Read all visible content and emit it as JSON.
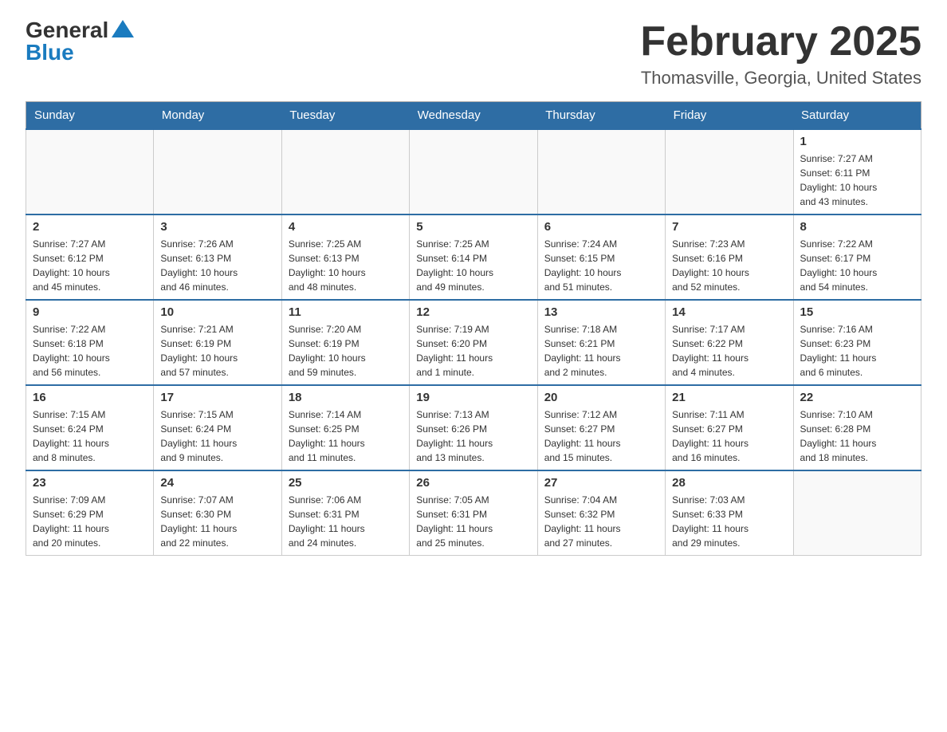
{
  "logo": {
    "general": "General",
    "blue": "Blue"
  },
  "header": {
    "month_year": "February 2025",
    "location": "Thomasville, Georgia, United States"
  },
  "weekdays": [
    "Sunday",
    "Monday",
    "Tuesday",
    "Wednesday",
    "Thursday",
    "Friday",
    "Saturday"
  ],
  "weeks": [
    [
      {
        "day": "",
        "info": ""
      },
      {
        "day": "",
        "info": ""
      },
      {
        "day": "",
        "info": ""
      },
      {
        "day": "",
        "info": ""
      },
      {
        "day": "",
        "info": ""
      },
      {
        "day": "",
        "info": ""
      },
      {
        "day": "1",
        "info": "Sunrise: 7:27 AM\nSunset: 6:11 PM\nDaylight: 10 hours\nand 43 minutes."
      }
    ],
    [
      {
        "day": "2",
        "info": "Sunrise: 7:27 AM\nSunset: 6:12 PM\nDaylight: 10 hours\nand 45 minutes."
      },
      {
        "day": "3",
        "info": "Sunrise: 7:26 AM\nSunset: 6:13 PM\nDaylight: 10 hours\nand 46 minutes."
      },
      {
        "day": "4",
        "info": "Sunrise: 7:25 AM\nSunset: 6:13 PM\nDaylight: 10 hours\nand 48 minutes."
      },
      {
        "day": "5",
        "info": "Sunrise: 7:25 AM\nSunset: 6:14 PM\nDaylight: 10 hours\nand 49 minutes."
      },
      {
        "day": "6",
        "info": "Sunrise: 7:24 AM\nSunset: 6:15 PM\nDaylight: 10 hours\nand 51 minutes."
      },
      {
        "day": "7",
        "info": "Sunrise: 7:23 AM\nSunset: 6:16 PM\nDaylight: 10 hours\nand 52 minutes."
      },
      {
        "day": "8",
        "info": "Sunrise: 7:22 AM\nSunset: 6:17 PM\nDaylight: 10 hours\nand 54 minutes."
      }
    ],
    [
      {
        "day": "9",
        "info": "Sunrise: 7:22 AM\nSunset: 6:18 PM\nDaylight: 10 hours\nand 56 minutes."
      },
      {
        "day": "10",
        "info": "Sunrise: 7:21 AM\nSunset: 6:19 PM\nDaylight: 10 hours\nand 57 minutes."
      },
      {
        "day": "11",
        "info": "Sunrise: 7:20 AM\nSunset: 6:19 PM\nDaylight: 10 hours\nand 59 minutes."
      },
      {
        "day": "12",
        "info": "Sunrise: 7:19 AM\nSunset: 6:20 PM\nDaylight: 11 hours\nand 1 minute."
      },
      {
        "day": "13",
        "info": "Sunrise: 7:18 AM\nSunset: 6:21 PM\nDaylight: 11 hours\nand 2 minutes."
      },
      {
        "day": "14",
        "info": "Sunrise: 7:17 AM\nSunset: 6:22 PM\nDaylight: 11 hours\nand 4 minutes."
      },
      {
        "day": "15",
        "info": "Sunrise: 7:16 AM\nSunset: 6:23 PM\nDaylight: 11 hours\nand 6 minutes."
      }
    ],
    [
      {
        "day": "16",
        "info": "Sunrise: 7:15 AM\nSunset: 6:24 PM\nDaylight: 11 hours\nand 8 minutes."
      },
      {
        "day": "17",
        "info": "Sunrise: 7:15 AM\nSunset: 6:24 PM\nDaylight: 11 hours\nand 9 minutes."
      },
      {
        "day": "18",
        "info": "Sunrise: 7:14 AM\nSunset: 6:25 PM\nDaylight: 11 hours\nand 11 minutes."
      },
      {
        "day": "19",
        "info": "Sunrise: 7:13 AM\nSunset: 6:26 PM\nDaylight: 11 hours\nand 13 minutes."
      },
      {
        "day": "20",
        "info": "Sunrise: 7:12 AM\nSunset: 6:27 PM\nDaylight: 11 hours\nand 15 minutes."
      },
      {
        "day": "21",
        "info": "Sunrise: 7:11 AM\nSunset: 6:27 PM\nDaylight: 11 hours\nand 16 minutes."
      },
      {
        "day": "22",
        "info": "Sunrise: 7:10 AM\nSunset: 6:28 PM\nDaylight: 11 hours\nand 18 minutes."
      }
    ],
    [
      {
        "day": "23",
        "info": "Sunrise: 7:09 AM\nSunset: 6:29 PM\nDaylight: 11 hours\nand 20 minutes."
      },
      {
        "day": "24",
        "info": "Sunrise: 7:07 AM\nSunset: 6:30 PM\nDaylight: 11 hours\nand 22 minutes."
      },
      {
        "day": "25",
        "info": "Sunrise: 7:06 AM\nSunset: 6:31 PM\nDaylight: 11 hours\nand 24 minutes."
      },
      {
        "day": "26",
        "info": "Sunrise: 7:05 AM\nSunset: 6:31 PM\nDaylight: 11 hours\nand 25 minutes."
      },
      {
        "day": "27",
        "info": "Sunrise: 7:04 AM\nSunset: 6:32 PM\nDaylight: 11 hours\nand 27 minutes."
      },
      {
        "day": "28",
        "info": "Sunrise: 7:03 AM\nSunset: 6:33 PM\nDaylight: 11 hours\nand 29 minutes."
      },
      {
        "day": "",
        "info": ""
      }
    ]
  ]
}
